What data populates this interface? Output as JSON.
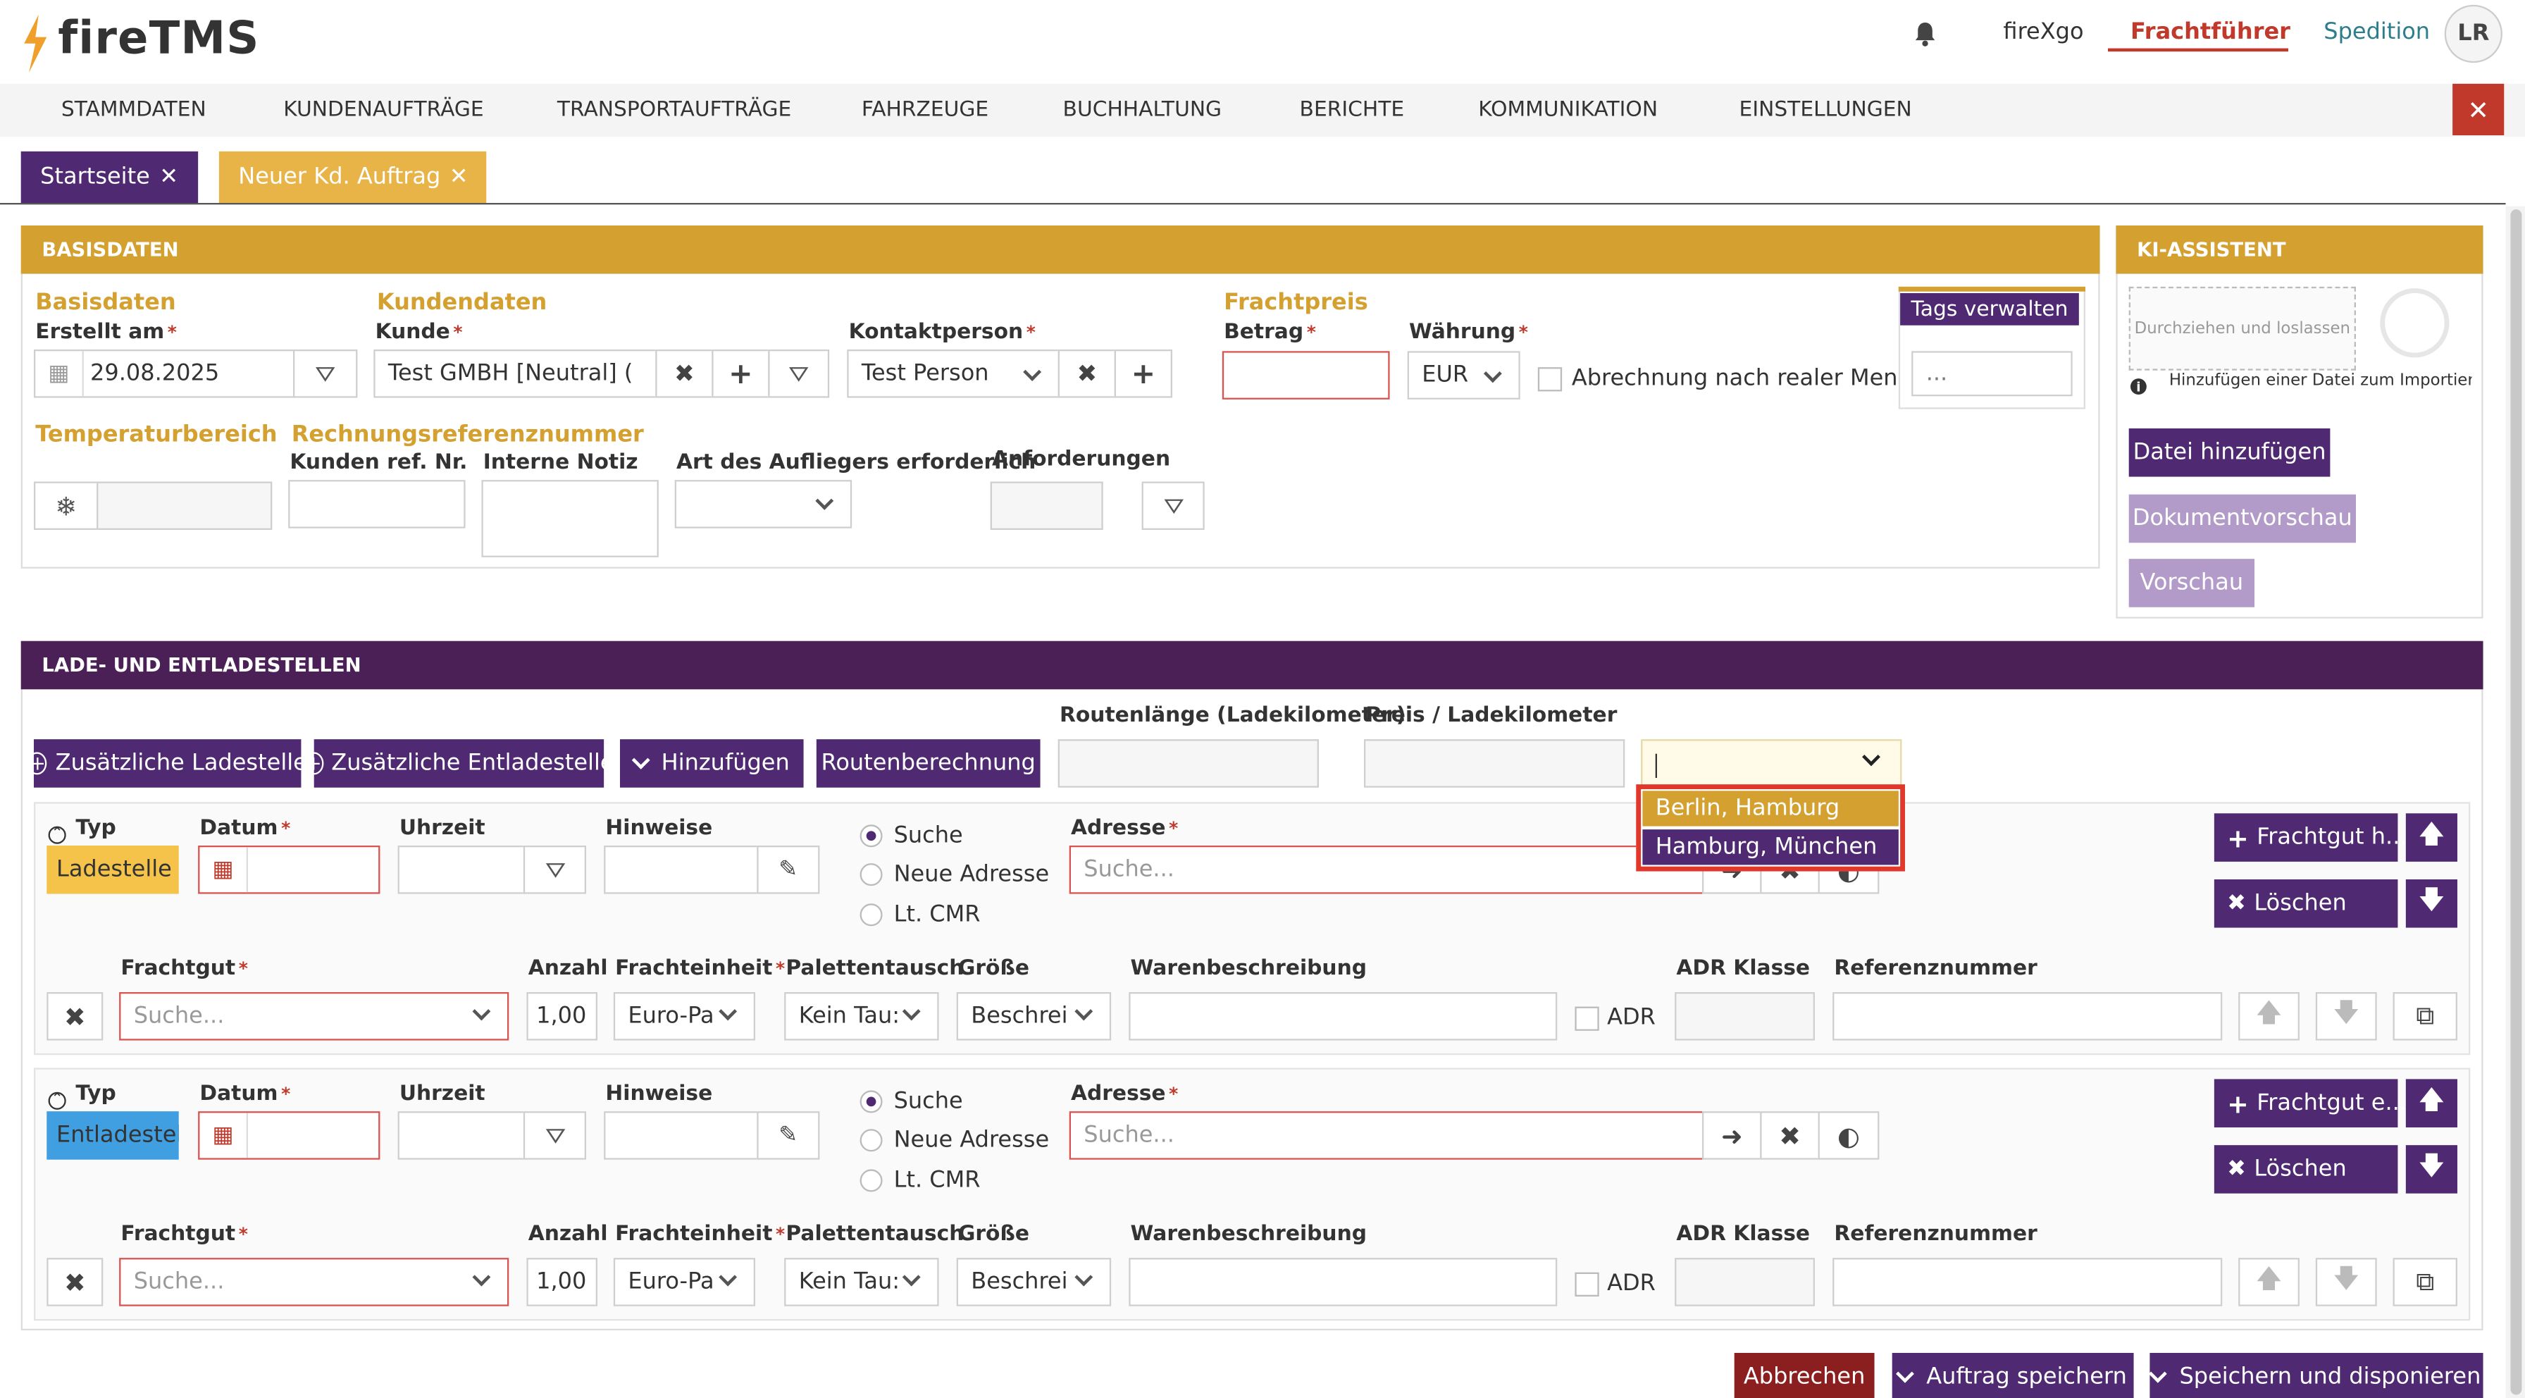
{
  "header": {
    "brand": "fireTMS",
    "company": "fireXgo",
    "tab_active": "Frachtführer",
    "tab_other": "Spedition",
    "avatar": "LR"
  },
  "menu": {
    "items": [
      "STAMMDATEN",
      "KUNDENAUFTRÄGE",
      "TRANSPORTAUFTRÄGE",
      "FAHRZEUGE",
      "BUCHHALTUNG",
      "BERICHTE",
      "KOMMUNIKATION",
      "EINSTELLUNGEN"
    ]
  },
  "tabs": [
    {
      "label": "Startseite"
    },
    {
      "label": "Neuer Kd. Auftrag"
    }
  ],
  "basisdaten": {
    "title": "BASISDATEN",
    "group_basis": "Basisdaten",
    "erstellt_label": "Erstellt am",
    "erstellt_value": "29.08.2025",
    "group_kunde": "Kundendaten",
    "kunde_label": "Kunde",
    "kunde_value": "Test GMBH [Neutral] (",
    "kontakt_label": "Kontaktperson",
    "kontakt_value": "Test Person",
    "group_fracht": "Frachtpreis",
    "betrag_label": "Betrag",
    "waehrung_label": "Währung",
    "waehrung_value": "EUR",
    "abrechnung_label": "Abrechnung nach realer Menge",
    "tags_button": "Tags verwalten",
    "tags_value": "...",
    "group_temp": "Temperaturbereich",
    "group_rechnung": "Rechnungsreferenznummer",
    "kundenref_label": "Kunden ref. Nr.",
    "notiz_label": "Interne Notiz",
    "auflieger_label": "Art des Aufliegers erforderlich",
    "anforderungen_label": "Anforderungen"
  },
  "ki": {
    "title": "KI-ASSISTENT",
    "drop_text": "Durchziehen und loslassen",
    "hint": "Hinzufügen einer Datei zum Importieren d",
    "add_file": "Datei hinzufügen",
    "doc_preview": "Dokumentvorschau",
    "preview": "Vorschau"
  },
  "stellen": {
    "title": "LADE- UND ENTLADESTELLEN",
    "btn_lade": "Zusätzliche Ladestelle",
    "btn_entlade": "Zusätzliche Entladestelle",
    "btn_add": "Hinzufügen",
    "btn_route": "Routenberechnung",
    "routenlaenge_label": "Routenlänge (Ladekilometer)",
    "preis_label": "Preis / Ladekilometer",
    "dropdown_options": [
      "Berlin, Hamburg",
      "Hamburg, München"
    ],
    "typ_label": "Typ",
    "datum_label": "Datum",
    "uhrzeit_label": "Uhrzeit",
    "hinweise_label": "Hinweise",
    "radio_suche": "Suche",
    "radio_neu": "Neue Adresse",
    "radio_cmr": "Lt. CMR",
    "adresse_label": "Adresse",
    "adresse_placeholder": "Suche...",
    "frachtgut_label": "Frachtgut",
    "frachtgut_placeholder": "Suche...",
    "anzahl_label": "Anzahl",
    "anzahl_value": "1,00",
    "frachteinheit_label": "Frachteinheit",
    "frachteinheit_value": "Euro-Pa",
    "paletten_label": "Palettentausch",
    "paletten_value": "Kein Tau:",
    "groesse_label": "Größe",
    "groesse_value": "Beschrei",
    "waren_label": "Warenbeschreibung",
    "adr_klasse_label": "ADR Klasse",
    "adr_label": "ADR",
    "ref_label": "Referenznummer",
    "loeschen": "Löschen",
    "stops": [
      {
        "type": "Ladestelle",
        "type_color": "#f5c24a",
        "fracht_btn": "Frachtgut h..."
      },
      {
        "type": "Entladestell",
        "type_color": "#3f9fe0",
        "fracht_btn": "Frachtgut e..."
      }
    ]
  },
  "footer": {
    "cancel": "Abbrechen",
    "save": "Auftrag speichern",
    "save_dispose": "Speichern und disponieren"
  },
  "colors": {
    "gold": "#d4a030",
    "purple": "#4f2a73",
    "light_purple": "#b39bc9",
    "dark_red": "#8b1e1e",
    "red": "#c0392b",
    "orange_logo": "#f0a02a"
  }
}
